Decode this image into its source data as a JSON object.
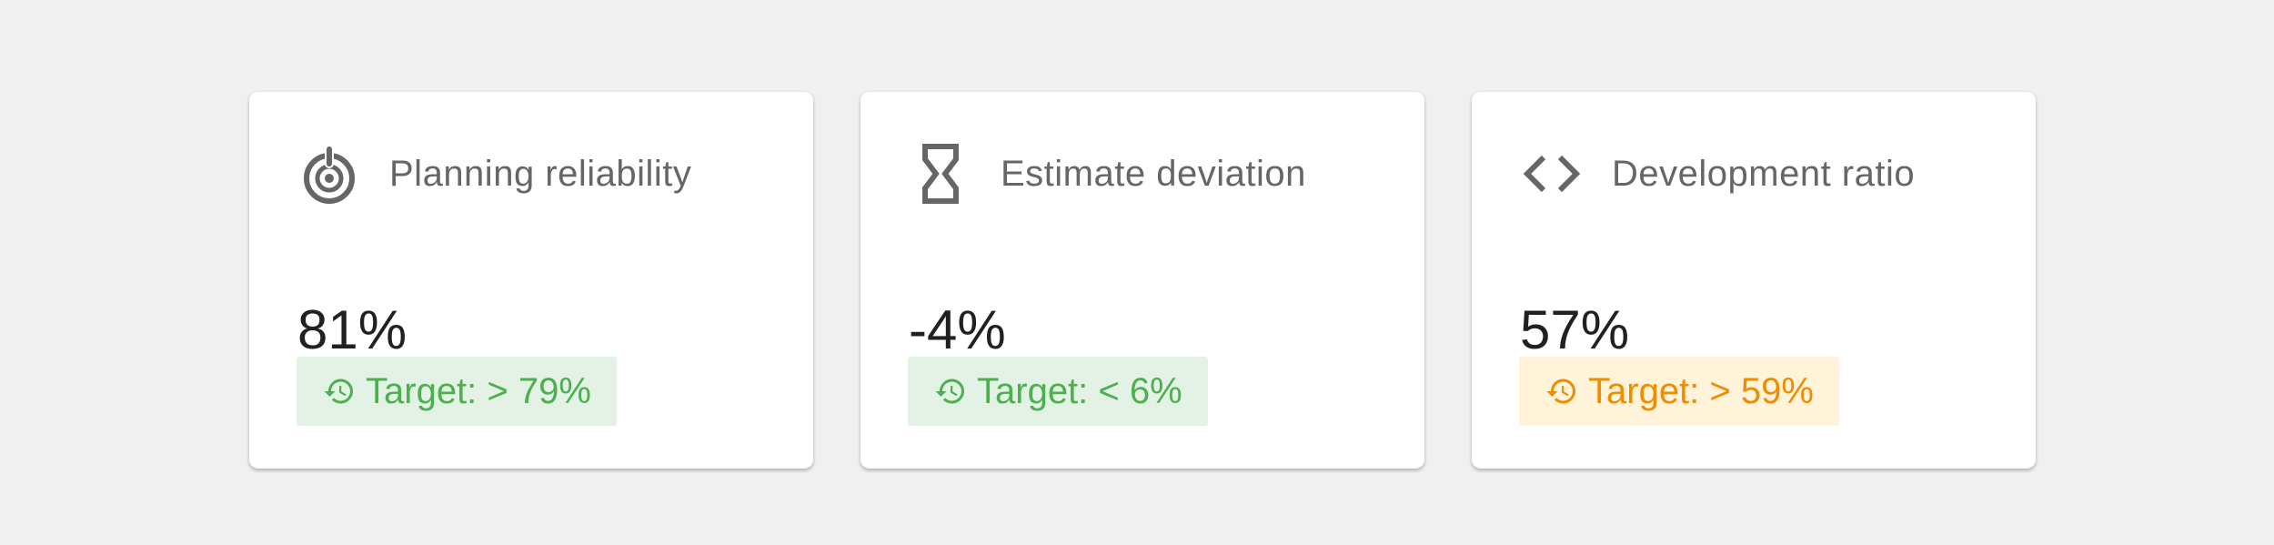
{
  "cards": [
    {
      "icon": "target-icon",
      "title": "Planning reliability",
      "value": "81%",
      "target": "Target: > 79%",
      "target_status": "ok",
      "target_color": "#4caf50",
      "target_bg": "#e3f2e4"
    },
    {
      "icon": "hourglass-icon",
      "title": "Estimate deviation",
      "value": "-4%",
      "target": "Target: < 6%",
      "target_status": "ok",
      "target_color": "#4caf50",
      "target_bg": "#e3f2e4"
    },
    {
      "icon": "code-icon",
      "title": "Development ratio",
      "value": "57%",
      "target": "Target: > 59%",
      "target_status": "warning",
      "target_color": "#ef8c00",
      "target_bg": "#fff3d9"
    }
  ],
  "chip_icon": "history-icon",
  "colors": {
    "background": "#f0f0f0",
    "card": "#ffffff",
    "title_text": "#666666",
    "value_text": "#212121"
  }
}
